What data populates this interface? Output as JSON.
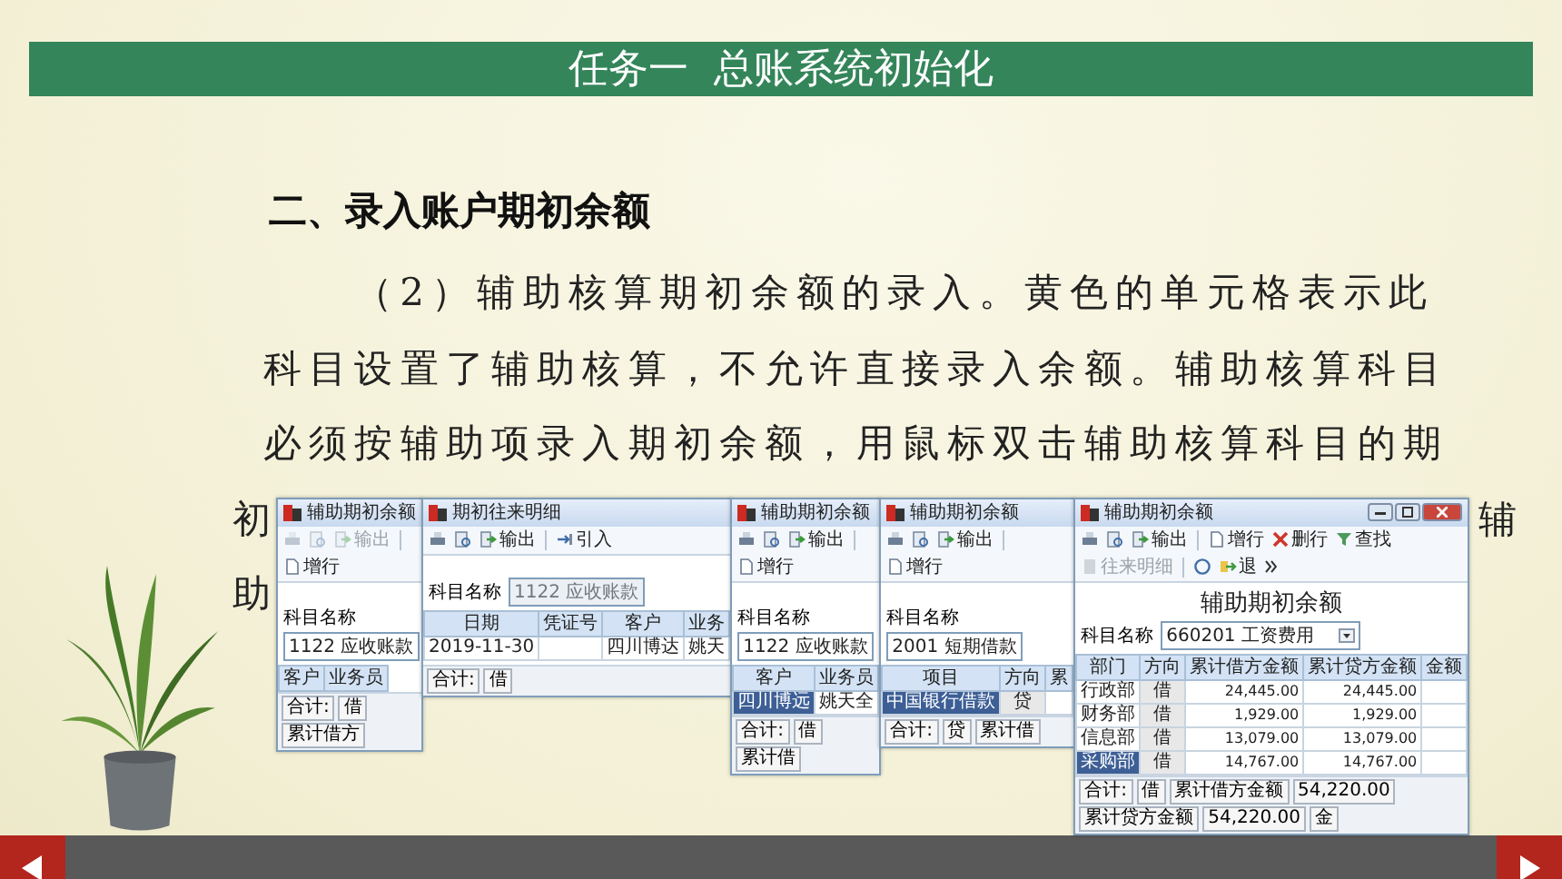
{
  "header": {
    "title": "任务一  总账系统初始化"
  },
  "section_heading": "二、录入账户期初余额",
  "paragraph_lines": [
    "（2）辅助核算期初余额的录入。黄色的单元格表示此",
    "科目设置了辅助核算，不允许直接录入余额。辅助核算科目",
    "必须按辅助项录入期初余额，用鼠标双击辅助核算科目的期"
  ],
  "fragments_left": [
    "初",
    "助"
  ],
  "fragments_right": [
    "辅"
  ],
  "windows": [
    {
      "title": "辅助期初余额",
      "window_controls": false,
      "toolbar": [
        {
          "kind": "print",
          "disabled": true
        },
        {
          "kind": "preview",
          "disabled": true
        },
        {
          "kind": "export",
          "label": "输出",
          "disabled": true
        },
        {
          "kind": "separator"
        },
        {
          "kind": "add_row",
          "label": "增行",
          "disabled": false
        }
      ],
      "subject": {
        "label": "科目名称",
        "value": "1122 应收账款",
        "disabled": false,
        "dropdown": false
      },
      "columns": [
        {
          "label": "客户",
          "kind": "text"
        },
        {
          "label": "业务员",
          "kind": "text"
        }
      ],
      "footer": [
        "合计:",
        "借",
        "累计借方"
      ]
    },
    {
      "title": "期初往来明细",
      "window_controls": false,
      "toolbar": [
        {
          "kind": "print",
          "disabled": false
        },
        {
          "kind": "preview",
          "disabled": false
        },
        {
          "kind": "export",
          "label": "输出",
          "disabled": false
        },
        {
          "kind": "separator"
        },
        {
          "kind": "import",
          "label": "引入",
          "disabled": false
        }
      ],
      "subject": {
        "label": "科目名称",
        "value": "1122 应收账款",
        "disabled": true,
        "dropdown": false
      },
      "columns": [
        {
          "label": "日期",
          "kind": "text"
        },
        {
          "label": "凭证号",
          "kind": "text"
        },
        {
          "label": "客户",
          "kind": "text"
        },
        {
          "label": "业务",
          "kind": "text"
        }
      ],
      "rows": [
        {
          "selected": false,
          "cells": [
            "2019-11-30",
            null,
            "四川博达",
            "姚天"
          ]
        }
      ],
      "footer": [
        "合计:",
        "借"
      ]
    },
    {
      "title": "辅助期初余额",
      "window_controls": false,
      "toolbar": [
        {
          "kind": "print",
          "disabled": false
        },
        {
          "kind": "preview",
          "disabled": false
        },
        {
          "kind": "export",
          "label": "输出",
          "disabled": false
        },
        {
          "kind": "separator"
        },
        {
          "kind": "add_row",
          "label": "增行",
          "disabled": false
        }
      ],
      "subject": {
        "label": "科目名称",
        "value": "1122 应收账款",
        "disabled": false,
        "dropdown": false
      },
      "columns": [
        {
          "label": "客户",
          "kind": "text"
        },
        {
          "label": "业务员",
          "kind": "text"
        }
      ],
      "rows": [
        {
          "selected": true,
          "cells": [
            "四川博远",
            "姚天全"
          ]
        }
      ],
      "footer": [
        "合计:",
        "借",
        "累计借"
      ]
    },
    {
      "title": "辅助期初余额",
      "window_controls": false,
      "toolbar": [
        {
          "kind": "print",
          "disabled": false
        },
        {
          "kind": "preview",
          "disabled": false
        },
        {
          "kind": "export",
          "label": "输出",
          "disabled": false
        },
        {
          "kind": "separator"
        },
        {
          "kind": "add_row",
          "label": "增行",
          "disabled": false
        }
      ],
      "subject": {
        "label": "科目名称",
        "value": "2001 短期借款",
        "disabled": false,
        "dropdown": false
      },
      "columns": [
        {
          "label": "项目",
          "kind": "text"
        },
        {
          "label": "方向",
          "kind": "flag"
        },
        {
          "label": "累",
          "kind": "amount"
        }
      ],
      "rows": [
        {
          "selected": true,
          "cells": [
            "中国银行借款",
            "贷",
            null
          ]
        }
      ],
      "footer": [
        "合计:",
        "贷",
        "累计借"
      ]
    },
    {
      "title": "辅助期初余额",
      "window_controls": true,
      "heading": "辅助期初余额",
      "toolbar": [
        {
          "kind": "print",
          "disabled": false
        },
        {
          "kind": "preview",
          "disabled": false
        },
        {
          "kind": "export",
          "label": "输出",
          "disabled": false
        },
        {
          "kind": "separator"
        },
        {
          "kind": "add_row",
          "label": "增行",
          "disabled": false
        },
        {
          "kind": "delete_row",
          "label": "删行",
          "disabled": false
        },
        {
          "kind": "find",
          "label": "查找",
          "disabled": false
        },
        {
          "kind": "detail",
          "label": "往来明细",
          "disabled": true
        },
        {
          "kind": "separator"
        },
        {
          "kind": "help",
          "disabled": false
        },
        {
          "kind": "exit",
          "label": "退",
          "disabled": false
        },
        {
          "kind": "overflow",
          "disabled": false
        }
      ],
      "subject": {
        "label": "科目名称",
        "value": "660201 工资费用",
        "disabled": false,
        "dropdown": true
      },
      "columns": [
        {
          "label": "部门",
          "kind": "text"
        },
        {
          "label": "方向",
          "kind": "flag"
        },
        {
          "label": "累计借方金额",
          "kind": "amount"
        },
        {
          "label": "累计贷方金额",
          "kind": "amount"
        },
        {
          "label": "金额",
          "kind": "amount"
        }
      ],
      "rows": [
        {
          "selected": false,
          "cells": [
            "行政部",
            "借",
            "24,445.00",
            "24,445.00",
            null
          ]
        },
        {
          "selected": false,
          "cells": [
            "财务部",
            "借",
            "1,929.00",
            "1,929.00",
            null
          ]
        },
        {
          "selected": false,
          "cells": [
            "信息部",
            "借",
            "13,079.00",
            "13,079.00",
            null
          ]
        },
        {
          "selected": true,
          "cells": [
            "采购部",
            "借",
            "14,767.00",
            "14,767.00",
            null
          ]
        }
      ],
      "footer": [
        "合计:",
        "借",
        "累计借方金额",
        "54,220.00",
        "累计贷方金额",
        "54,220.00",
        "金"
      ]
    }
  ]
}
